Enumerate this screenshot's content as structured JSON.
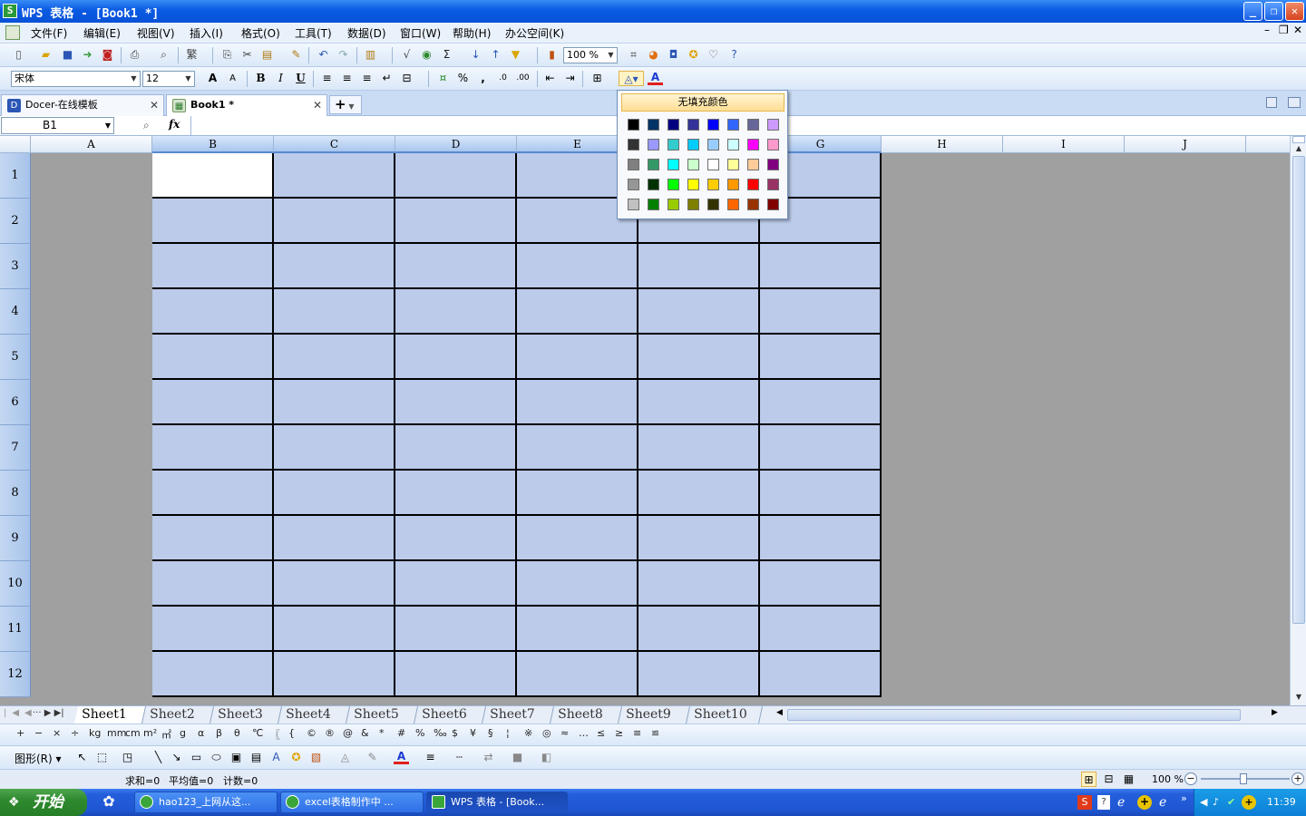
{
  "window": {
    "title": "WPS 表格 - [Book1 *]",
    "logo": "S",
    "min": "_",
    "restore": "❐",
    "close": "✕"
  },
  "menu": [
    "文件(F)",
    "编辑(E)",
    "视图(V)",
    "插入(I)",
    "格式(O)",
    "工具(T)",
    "数据(D)",
    "窗口(W)",
    "帮助(H)",
    "办公空间(K)"
  ],
  "toolbar": {
    "zoom": "100 %"
  },
  "format_toolbar": {
    "font": "宋体",
    "size": "12",
    "bold": "B",
    "italic": "I",
    "underline": "U",
    "percent": "%",
    "comma": ","
  },
  "doc_tabs": [
    {
      "label": "Docer-在线模板"
    },
    {
      "label": "Book1 *"
    }
  ],
  "new_tab": "+",
  "formula": {
    "name_box": "B1",
    "fx": "fx"
  },
  "columns": [
    "A",
    "B",
    "C",
    "D",
    "E",
    "F",
    "G",
    "H",
    "I",
    "J"
  ],
  "rows": [
    "1",
    "2",
    "3",
    "4",
    "5",
    "6",
    "7",
    "8",
    "9",
    "10",
    "11",
    "12"
  ],
  "sheet_tabs": [
    "Sheet1",
    "Sheet2",
    "Sheet3",
    "Sheet4",
    "Sheet5",
    "Sheet6",
    "Sheet7",
    "Sheet8",
    "Sheet9",
    "Sheet10"
  ],
  "symbols": [
    "+",
    "−",
    "×",
    "÷",
    "kg",
    "mm",
    "cm",
    "m²",
    "㎡",
    "g",
    "α",
    "β",
    "θ",
    "℃",
    "〖",
    "{",
    "©",
    "®",
    "@",
    "&",
    "*",
    "#",
    "%",
    "‰",
    "$",
    "¥",
    "§",
    "¦",
    "※",
    "◎",
    "≈",
    "…",
    "≤",
    "≥",
    "≡",
    "≌"
  ],
  "draw_toolbar": {
    "shapes": "图形(R)"
  },
  "status": {
    "sum": "求和=0",
    "avg": "平均值=0",
    "count": "计数=0",
    "zoom": "100 %"
  },
  "palette": {
    "no_fill": "无填充颜色",
    "colors": [
      [
        "#000000",
        "#003366",
        "#000080",
        "#333399",
        "#0000ff",
        "#3366ff",
        "#666699",
        "#cc99ff"
      ],
      [
        "#333333",
        "#9999ff",
        "#33cccc",
        "#00ccff",
        "#99ccff",
        "#ccffff",
        "#ff00ff",
        "#ff99cc"
      ],
      [
        "#808080",
        "#339966",
        "#00ffff",
        "#ccffcc",
        "#ffffff",
        "#ffff99",
        "#ffcc99",
        "#800080"
      ],
      [
        "#969696",
        "#003300",
        "#00ff00",
        "#ffff00",
        "#ffcc00",
        "#ff9900",
        "#ff0000",
        "#993366"
      ],
      [
        "#c0c0c0",
        "#008000",
        "#99cc00",
        "#808000",
        "#333300",
        "#ff6600",
        "#993300",
        "#800000"
      ]
    ]
  },
  "taskbar": {
    "start": "开始",
    "tasks": [
      "hao123_上网从这...",
      "excel表格制作中 ...",
      "WPS 表格 - [Book..."
    ],
    "clock": "11:39"
  }
}
